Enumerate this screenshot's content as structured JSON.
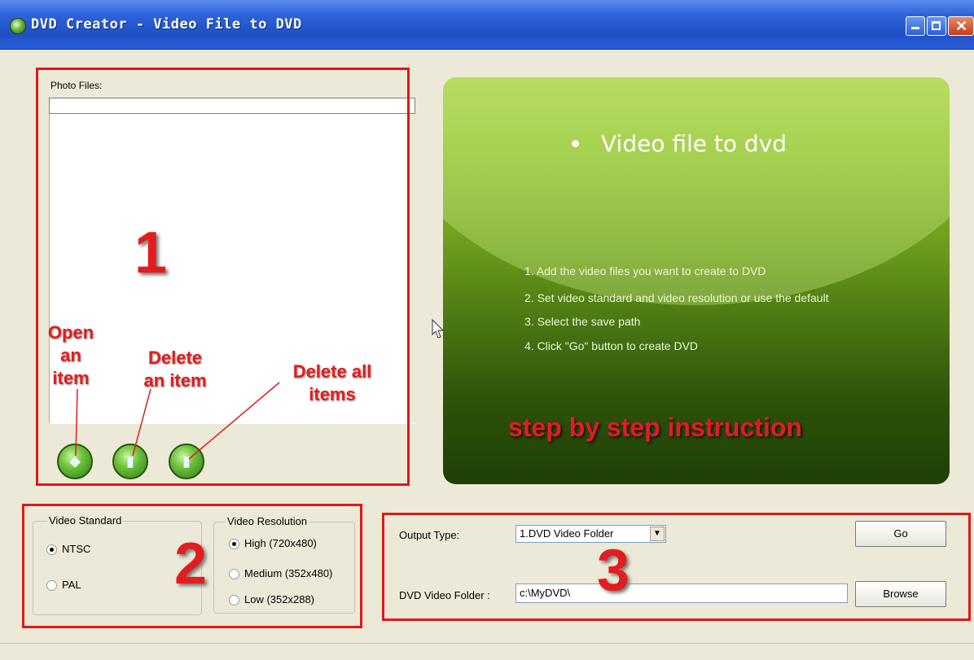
{
  "window": {
    "title": "DVD Creator - Video File to DVD"
  },
  "files_panel": {
    "label": "Photo Files:",
    "buttons": [
      "open-item",
      "delete-item",
      "delete-all-items"
    ]
  },
  "info_panel": {
    "title": "Video file to dvd",
    "steps": [
      "1. Add the video files you want to create to DVD",
      "2. Set video standard and video resolution or use the default",
      "3. Select the save path",
      "4. Click \"Go\" button to create DVD"
    ]
  },
  "video_standard": {
    "title": "Video Standard",
    "options": [
      {
        "label": "NTSC",
        "selected": true
      },
      {
        "label": "PAL",
        "selected": false
      }
    ]
  },
  "video_resolution": {
    "title": "Video Resolution",
    "options": [
      {
        "label": "High (720x480)",
        "selected": true
      },
      {
        "label": "Medium (352x480)",
        "selected": false
      },
      {
        "label": "Low (352x288)",
        "selected": false
      }
    ]
  },
  "output": {
    "type_label": "Output Type:",
    "type_value": "1.DVD Video Folder",
    "folder_label": "DVD Video Folder :",
    "folder_value": "c:\\MyDVD\\",
    "go_label": "Go",
    "browse_label": "Browse"
  },
  "annotations": {
    "num1": "1",
    "num2": "2",
    "num3": "3",
    "open_item": [
      "Open",
      "an",
      "item"
    ],
    "delete_item": [
      "Delete",
      "an item"
    ],
    "delete_all": [
      "Delete all",
      "items"
    ],
    "instruction": "step by step instruction"
  },
  "colors": {
    "annotation_red": "#e21d1d",
    "title_blue": "#2f63d9",
    "panel_green": "#6a9b1c"
  }
}
